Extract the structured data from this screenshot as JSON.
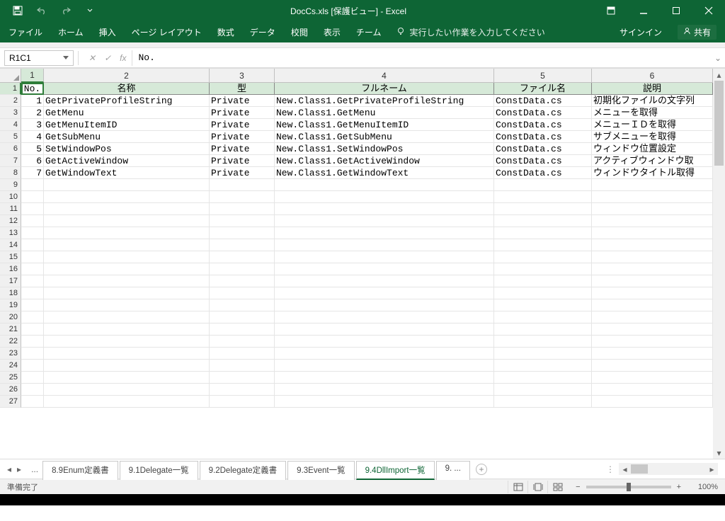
{
  "app": {
    "title": "DocCs.xls  [保護ビュー] - Excel",
    "signin": "サインイン",
    "share": "共有",
    "tell_me_placeholder": "実行したい作業を入力してください"
  },
  "ribbon_tabs": [
    "ファイル",
    "ホーム",
    "挿入",
    "ページ レイアウト",
    "数式",
    "データ",
    "校閲",
    "表示",
    "チーム"
  ],
  "name_box": "R1C1",
  "formula_value": "No.",
  "column_numbers": [
    "1",
    "2",
    "3",
    "4",
    "5",
    "6"
  ],
  "row_numbers": [
    "1",
    "2",
    "3",
    "4",
    "5",
    "6",
    "7",
    "8",
    "9",
    "10",
    "11",
    "12",
    "13",
    "14",
    "15",
    "16",
    "17",
    "18",
    "19",
    "20",
    "21",
    "22",
    "23",
    "24",
    "25",
    "26",
    "27"
  ],
  "headers": [
    "No.",
    "名称",
    "型",
    "フルネーム",
    "ファイル名",
    "説明"
  ],
  "rows": [
    {
      "no": "1",
      "name": "GetPrivateProfileString",
      "type": "Private",
      "full": "New.Class1.GetPrivateProfileString",
      "file": "ConstData.cs",
      "desc": "初期化ファイルの文字列"
    },
    {
      "no": "2",
      "name": "GetMenu",
      "type": "Private",
      "full": "New.Class1.GetMenu",
      "file": "ConstData.cs",
      "desc": "メニューを取得"
    },
    {
      "no": "3",
      "name": "GetMenuItemID",
      "type": "Private",
      "full": "New.Class1.GetMenuItemID",
      "file": "ConstData.cs",
      "desc": "メニューＩＤを取得"
    },
    {
      "no": "4",
      "name": "GetSubMenu",
      "type": "Private",
      "full": "New.Class1.GetSubMenu",
      "file": "ConstData.cs",
      "desc": "サブメニューを取得"
    },
    {
      "no": "5",
      "name": "SetWindowPos",
      "type": "Private",
      "full": "New.Class1.SetWindowPos",
      "file": "ConstData.cs",
      "desc": "ウィンドウ位置設定"
    },
    {
      "no": "6",
      "name": "GetActiveWindow",
      "type": "Private",
      "full": "New.Class1.GetActiveWindow",
      "file": "ConstData.cs",
      "desc": "アクティブウィンドウ取"
    },
    {
      "no": "7",
      "name": "GetWindowText",
      "type": "Private",
      "full": "New.Class1.GetWindowText",
      "file": "ConstData.cs",
      "desc": "ウィンドウタイトル取得"
    }
  ],
  "sheet_tabs": {
    "visible": [
      "8.9Enum定義書",
      "9.1Delegate一覧",
      "9.2Delegate定義書",
      "9.3Event一覧",
      "9.4DllImport一覧",
      "9. ..."
    ],
    "active_index": 4
  },
  "status": {
    "ready": "準備完了",
    "zoom": "100%"
  }
}
